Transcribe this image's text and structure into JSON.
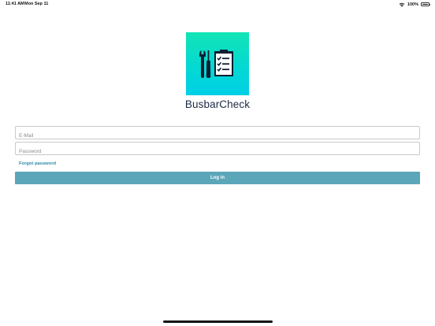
{
  "status_bar": {
    "time": "11:41 AM",
    "date": "Mon Sep 11",
    "battery_percent": "100%",
    "icons": [
      "wifi-icon",
      "battery-icon"
    ]
  },
  "app": {
    "logo_icon": "wrench-screwdriver-checklist-icon",
    "title": "BusbarCheck"
  },
  "login_form": {
    "email_placeholder": "E-Mail",
    "email_value": "",
    "password_placeholder": "Password",
    "password_value": "",
    "forgot_password_label": "Forgot password",
    "login_button_label": "Log in"
  },
  "colors": {
    "logo_gradient_top": "#12e4b5",
    "logo_gradient_bottom": "#00cfe6",
    "button_background": "#5ba6b8",
    "link_color": "#2a8aa8",
    "title_color": "#1e2a44"
  }
}
